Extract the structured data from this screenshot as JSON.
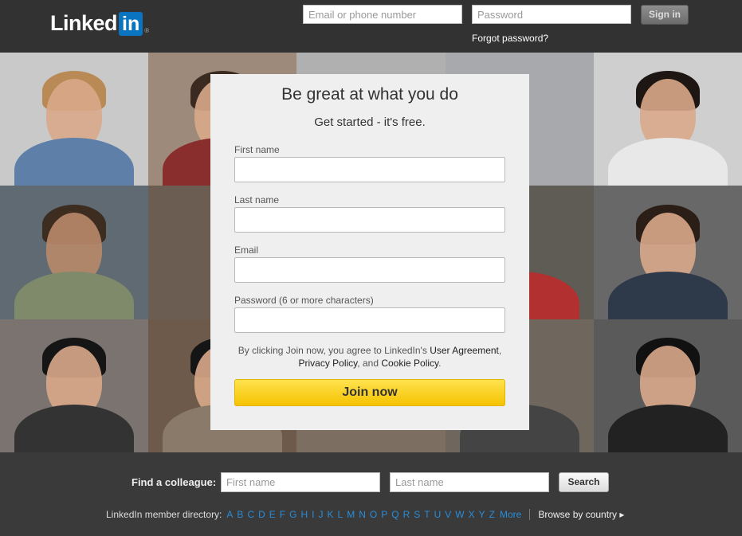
{
  "header": {
    "logo_text": "Linked",
    "logo_in": "in",
    "logo_reg": "®",
    "email_placeholder": "Email or phone number",
    "password_placeholder": "Password",
    "signin_label": "Sign in",
    "forgot_label": "Forgot password?"
  },
  "signup": {
    "title": "Be great at what you do",
    "subtitle": "Get started - it's free.",
    "first_name_label": "First name",
    "last_name_label": "Last name",
    "email_label": "Email",
    "password_label": "Password (6 or more characters)",
    "terms_prefix": "By clicking Join now, you agree to LinkedIn's ",
    "user_agreement": "User Agreement",
    "terms_comma": ",",
    "privacy_policy": "Privacy Policy",
    "terms_and": ", and ",
    "cookie_policy": "Cookie Policy",
    "terms_period": ".",
    "join_label": "Join now"
  },
  "footer": {
    "find_label": "Find a colleague:",
    "first_placeholder": "First name",
    "last_placeholder": "Last name",
    "search_label": "Search",
    "directory_label": "LinkedIn member directory:",
    "letters": [
      "A",
      "B",
      "C",
      "D",
      "E",
      "F",
      "G",
      "H",
      "I",
      "J",
      "K",
      "L",
      "M",
      "N",
      "O",
      "P",
      "Q",
      "R",
      "S",
      "T",
      "U",
      "V",
      "W",
      "X",
      "Y",
      "Z"
    ],
    "more_label": "More",
    "browse_label": "Browse by country ▸"
  },
  "colors": {
    "header_bg": "#323232",
    "accent_blue": "#0a74c0",
    "join_yellow": "#f5c200",
    "link_blue": "#2a8cd6"
  }
}
